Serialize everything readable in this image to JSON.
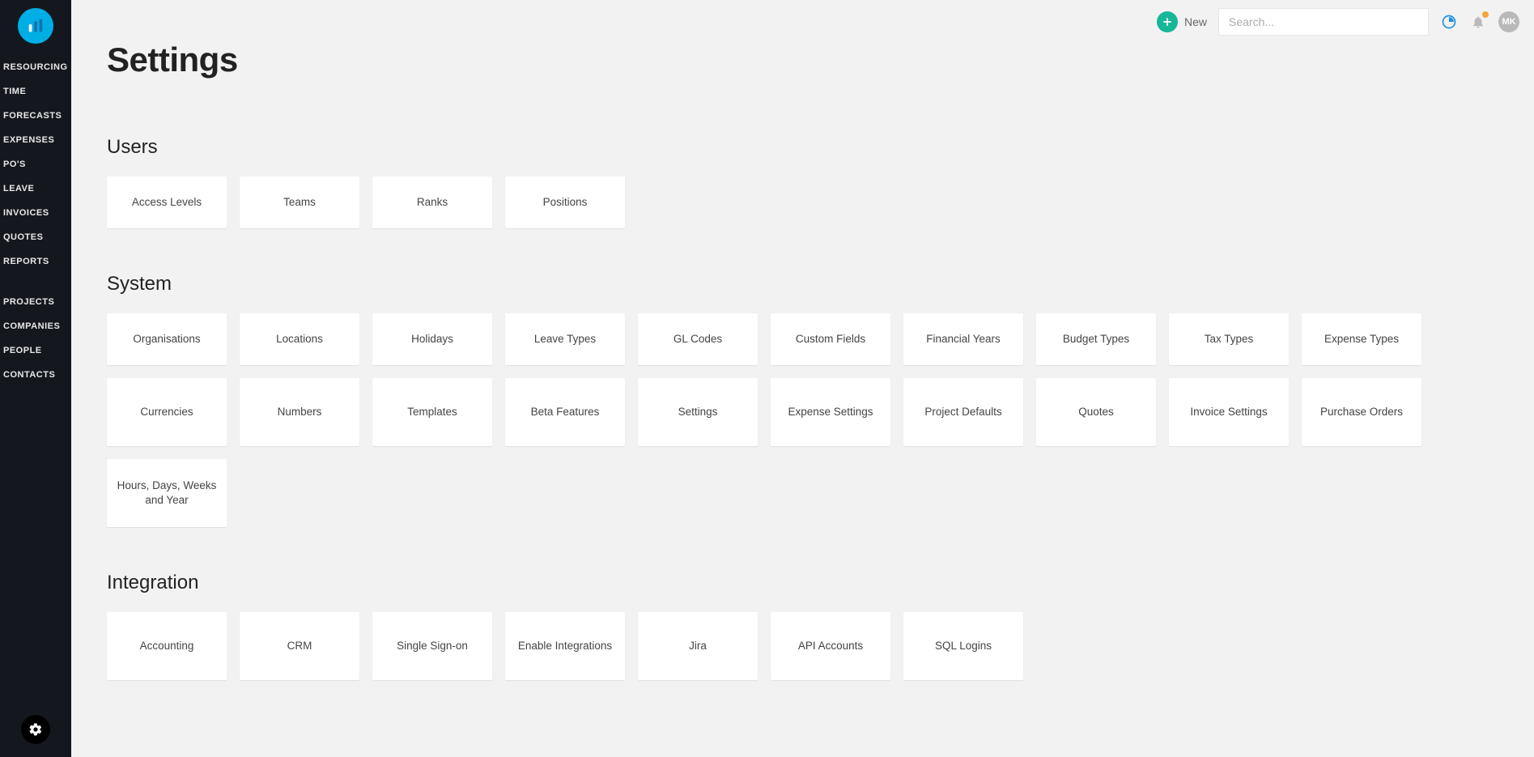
{
  "sidebar": {
    "nav_top": [
      "RESOURCING",
      "TIME",
      "FORECASTS",
      "EXPENSES",
      "PO'S",
      "LEAVE",
      "INVOICES",
      "QUOTES",
      "REPORTS"
    ],
    "nav_bottom": [
      "PROJECTS",
      "COMPANIES",
      "PEOPLE",
      "CONTACTS"
    ]
  },
  "topbar": {
    "new_label": "New",
    "search_placeholder": "Search...",
    "avatar_initials": "MK"
  },
  "page": {
    "title": "Settings"
  },
  "sections": {
    "users": {
      "title": "Users",
      "cards": [
        "Access Levels",
        "Teams",
        "Ranks",
        "Positions"
      ]
    },
    "system": {
      "title": "System",
      "cards": [
        "Organisations",
        "Locations",
        "Holidays",
        "Leave Types",
        "GL Codes",
        "Custom Fields",
        "Financial Years",
        "Budget Types",
        "Tax Types",
        "Expense Types",
        "Currencies",
        "Numbers",
        "Templates",
        "Beta Features",
        "Settings",
        "Expense Settings",
        "Project Defaults",
        "Quotes",
        "Invoice Settings",
        "Purchase Orders",
        "Hours, Days, Weeks and Year"
      ]
    },
    "integration": {
      "title": "Integration",
      "cards": [
        "Accounting",
        "CRM",
        "Single Sign-on",
        "Enable Integrations",
        "Jira",
        "API Accounts",
        "SQL Logins"
      ]
    }
  }
}
